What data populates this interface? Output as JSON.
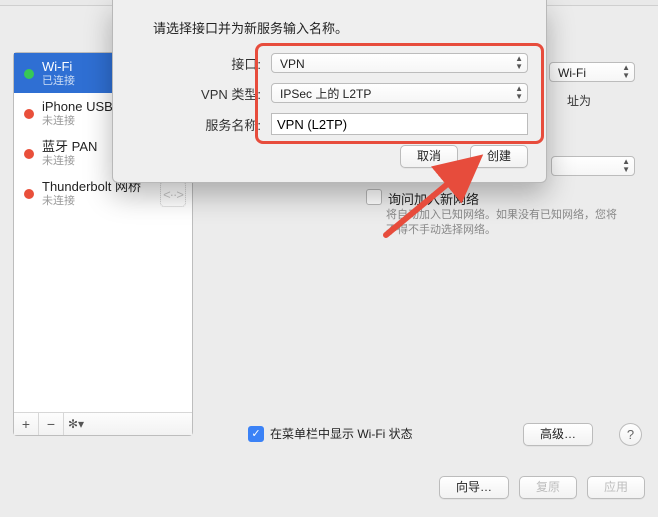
{
  "sidebar": {
    "items": [
      {
        "name": "Wi-Fi",
        "status": "已连接",
        "dot": "green",
        "selected": true
      },
      {
        "name": "iPhone USB",
        "status": "未连接",
        "dot": "red"
      },
      {
        "name": "蓝牙 PAN",
        "status": "未连接",
        "dot": "red"
      },
      {
        "name": "Thunderbolt 网桥",
        "status": "未连接",
        "dot": "red",
        "sync": true
      }
    ],
    "footer": {
      "add": "+",
      "remove": "−",
      "gear": "✻▾"
    }
  },
  "right": {
    "peek_network": "Wi-Fi",
    "peek_suffix": "址为",
    "ask_label": "询问加入新网络",
    "ask_desc": "将自动加入已知网络。如果没有已知网络，您将不得不手动选择网络。",
    "menubar_label": "在菜单栏中显示 Wi-Fi 状态",
    "advanced": "高级…"
  },
  "bottom": {
    "assist": "向导…",
    "revert": "复原",
    "apply": "应用"
  },
  "sheet": {
    "title": "请选择接口并为新服务输入名称。",
    "interface_label": "接口:",
    "interface_value": "VPN",
    "vpntype_label": "VPN 类型:",
    "vpntype_value": "IPSec 上的 L2TP",
    "servicename_label": "服务名称:",
    "servicename_value": "VPN (L2TP)",
    "cancel": "取消",
    "create": "创建"
  }
}
